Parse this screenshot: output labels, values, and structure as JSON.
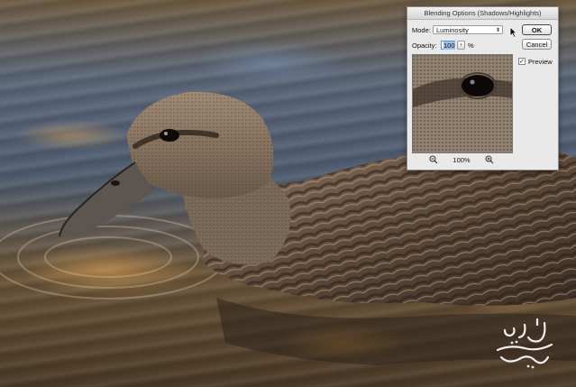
{
  "dialog": {
    "title": "Blending Options (Shadows/Highlights)",
    "mode_label": "Mode:",
    "mode_value": "Luminosity",
    "opacity_label": "Opacity:",
    "opacity_value": "100",
    "opacity_unit": "%",
    "ok_label": "OK",
    "cancel_label": "Cancel",
    "preview_label": "Preview",
    "preview_checked": true,
    "zoom_value": "100%"
  },
  "watermark": {
    "text": "ترانه یوسفی"
  }
}
